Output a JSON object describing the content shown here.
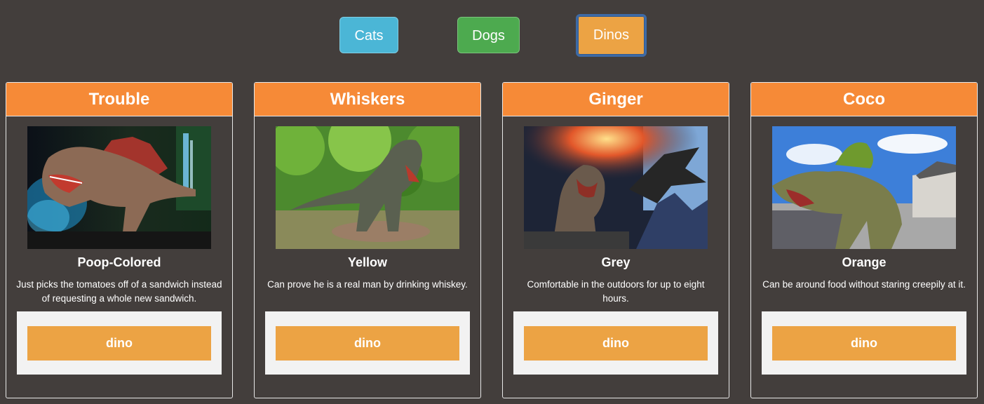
{
  "filters": {
    "cats": "Cats",
    "dogs": "Dogs",
    "dinos": "Dinos",
    "active": "Dinos"
  },
  "colors": {
    "background": "#433e3c",
    "card_header": "#f68a37",
    "cats_button": "#4bb6d6",
    "dogs_button": "#4daa4f",
    "dinos_button": "#eca344",
    "active_outline": "#3d6aa6",
    "footer_panel": "#f2f2f2"
  },
  "cards": [
    {
      "name": "Trouble",
      "color": "Poop-Colored",
      "description": "Just picks the tomatoes off of a sandwich instead of requesting a whole new sandwich.",
      "type": "dino",
      "image": "spinosaurus-cave-photo"
    },
    {
      "name": "Whiskers",
      "color": "Yellow",
      "description": "Can prove he is a real man by drinking whiskey.",
      "type": "dino",
      "image": "trex-forest-photo"
    },
    {
      "name": "Ginger",
      "color": "Grey",
      "description": "Comfortable in the outdoors for up to eight hours.",
      "type": "dino",
      "image": "trex-pterodactyl-explosion-photo"
    },
    {
      "name": "Coco",
      "color": "Orange",
      "description": "Can be around food without staring creepily at it.",
      "type": "dino",
      "image": "spinosaurus-village-photo"
    }
  ]
}
